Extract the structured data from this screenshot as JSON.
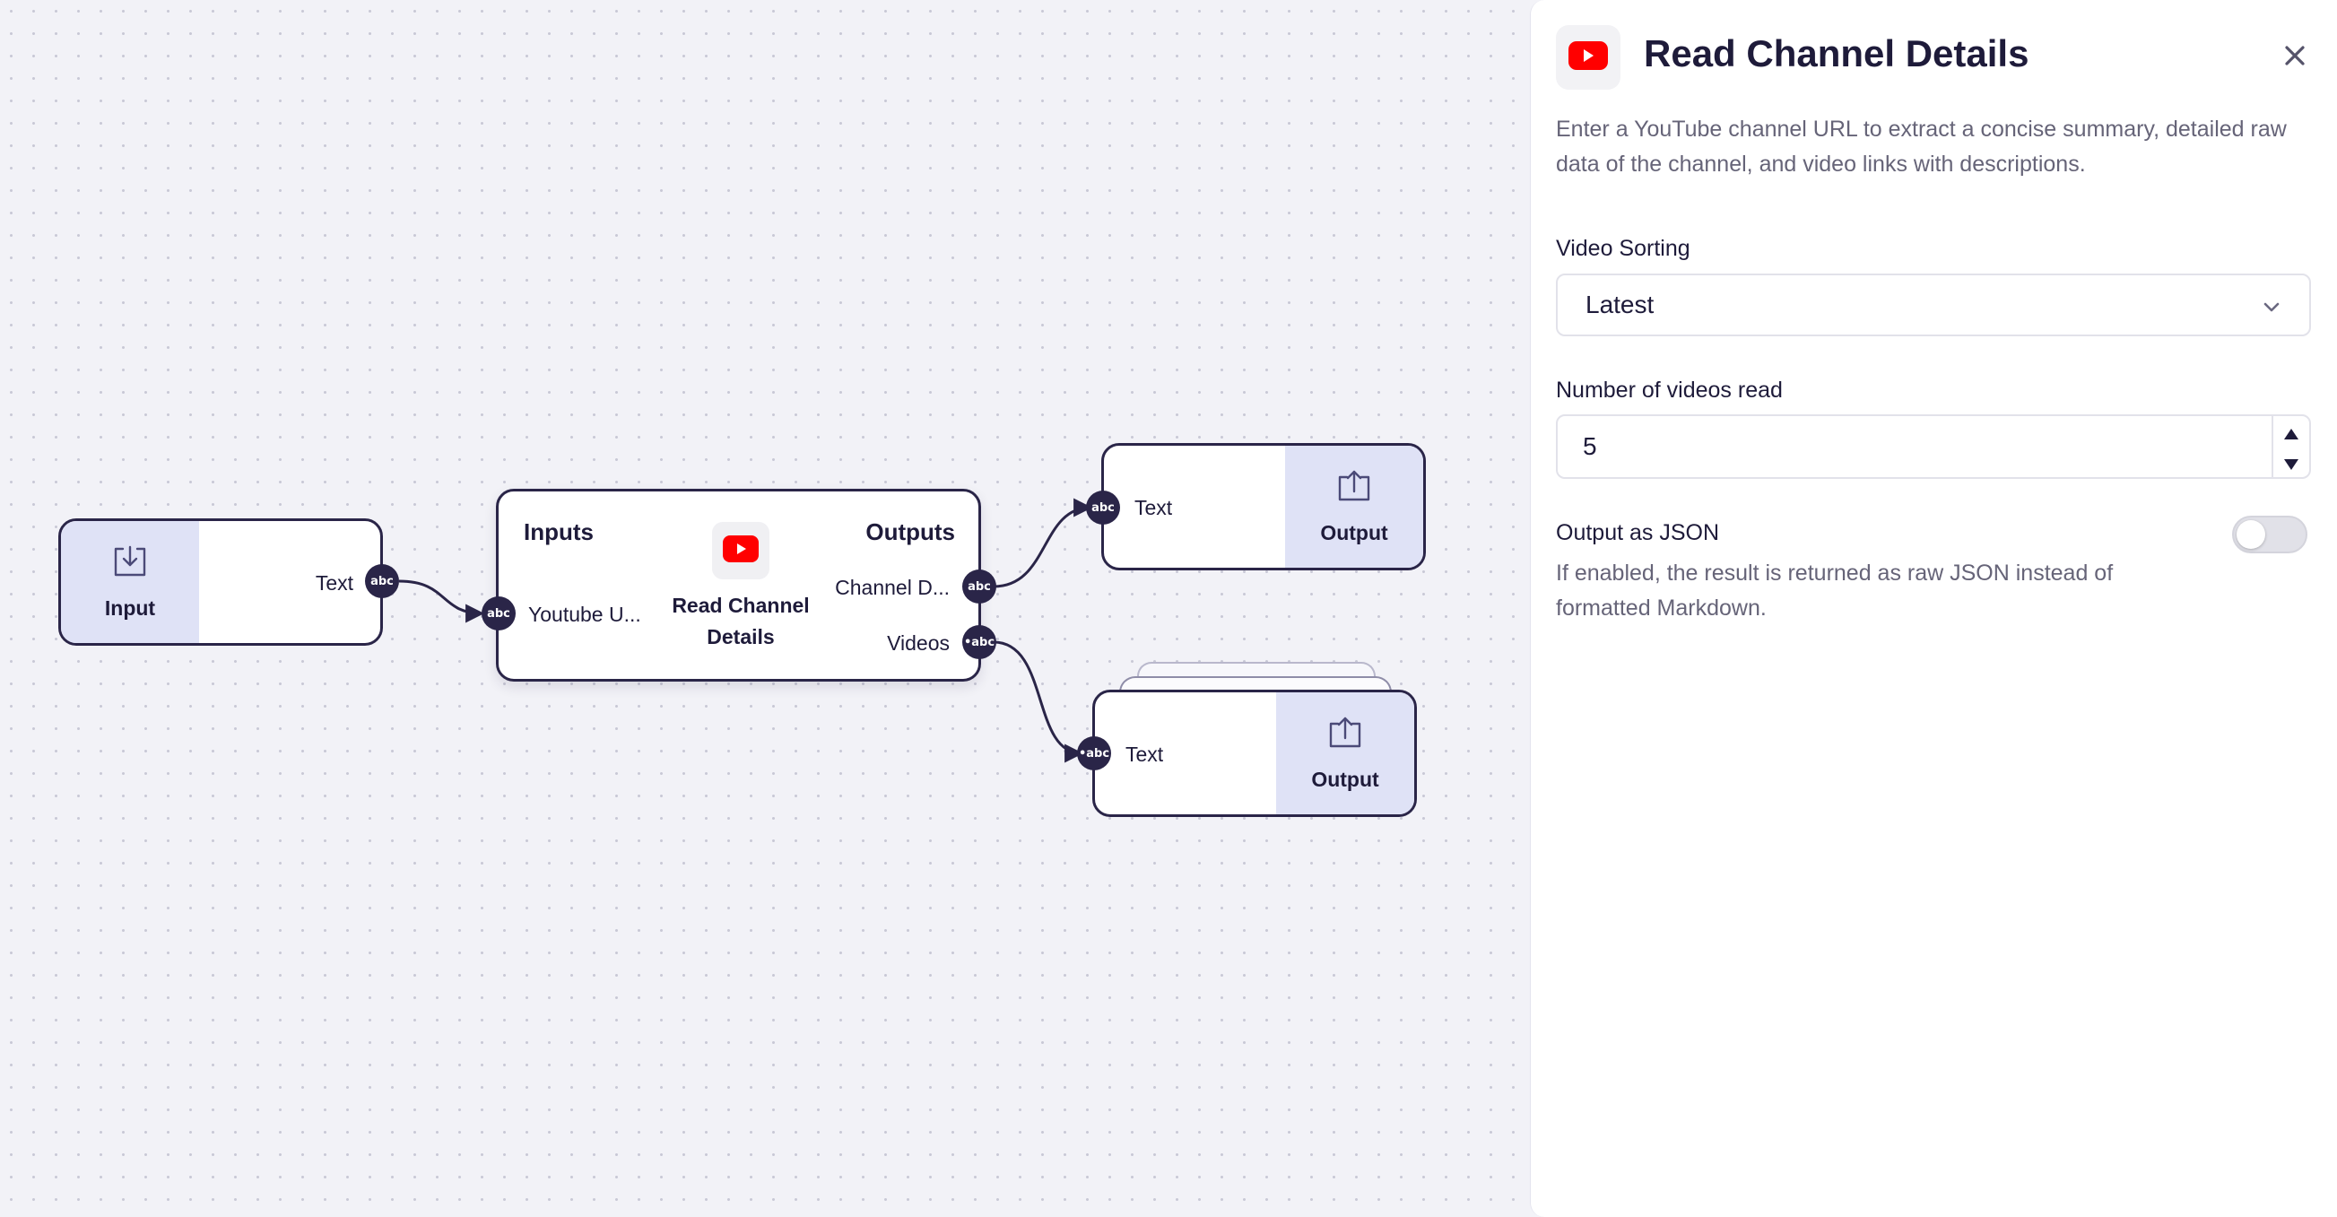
{
  "colors": {
    "node_border": "#2a2548",
    "node_accent": "#dfe2f6",
    "youtube_red": "#ff0000",
    "edge": "#2a2548"
  },
  "nodes": {
    "input": {
      "title": "Input",
      "port_label": "Text",
      "port_badge": "abc",
      "icon": "download-tray-icon"
    },
    "read_channel": {
      "inputs_heading": "Inputs",
      "outputs_heading": "Outputs",
      "title_line1": "Read Channel",
      "title_line2": "Details",
      "input_port_label": "Youtube U...",
      "input_port_badge": "abc",
      "output_port_1_label": "Channel D...",
      "output_port_1_badge": "abc",
      "output_port_2_label": "Videos",
      "output_port_2_badge": "•abc",
      "icon": "youtube-icon"
    },
    "output_1": {
      "title": "Output",
      "port_label": "Text",
      "port_badge": "abc",
      "icon": "upload-tray-icon"
    },
    "output_2": {
      "title": "Output",
      "port_label": "Text",
      "port_badge": "•abc",
      "icon": "upload-tray-icon"
    }
  },
  "panel": {
    "title": "Read Channel Details",
    "description": "Enter a YouTube channel URL to extract a concise summary, detailed raw data of the channel, and video links with descriptions.",
    "video_sorting": {
      "label": "Video Sorting",
      "value": "Latest"
    },
    "videos_read": {
      "label": "Number of videos read",
      "value": "5"
    },
    "output_json": {
      "label": "Output as JSON",
      "enabled": false,
      "help": "If enabled, the result is returned as raw JSON instead of formatted Markdown."
    }
  }
}
